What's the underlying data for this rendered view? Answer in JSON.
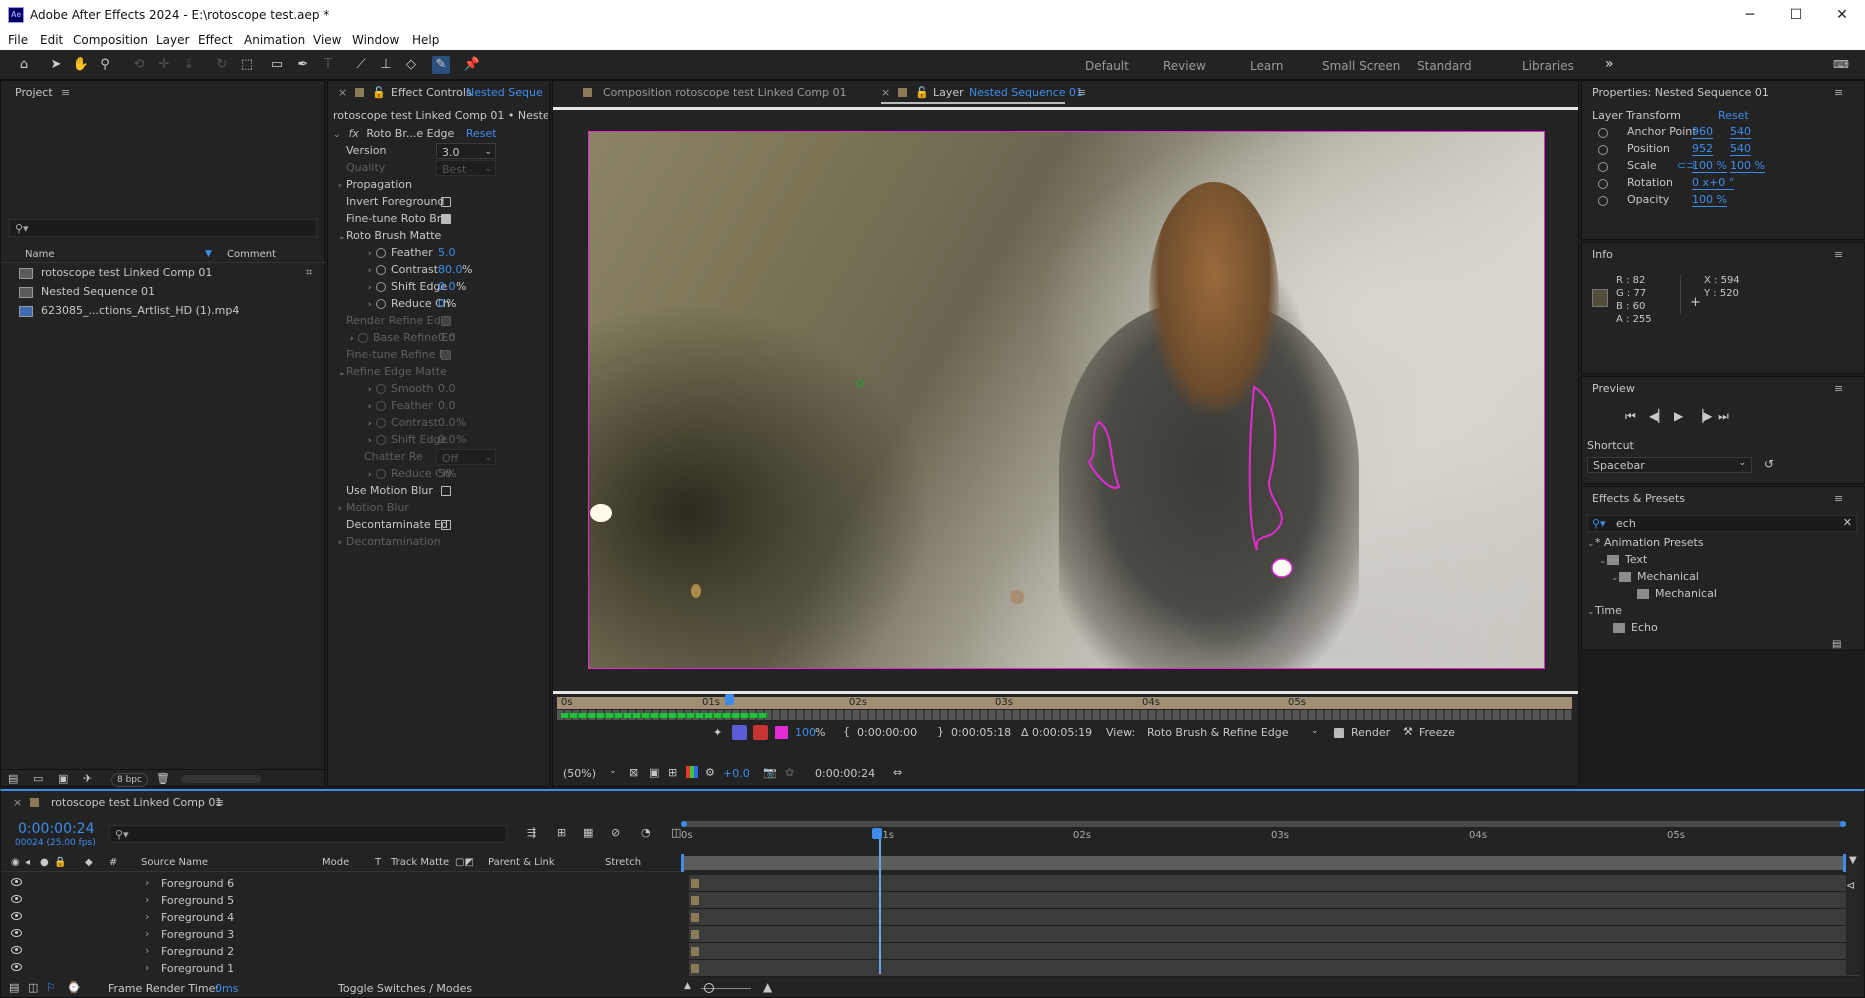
{
  "window": {
    "title": "Adobe After Effects 2024 - E:\\rotoscope test.aep *",
    "app_icon": "Ae",
    "minimize": "─",
    "maximize": "☐",
    "close": "✕"
  },
  "menu": [
    "File",
    "Edit",
    "Composition",
    "Layer",
    "Effect",
    "Animation",
    "View",
    "Window",
    "Help"
  ],
  "workspaces": [
    "Default",
    "Review",
    "Learn",
    "Small Screen",
    "Standard",
    "Libraries"
  ],
  "workspace_more": "»",
  "project": {
    "title": "Project",
    "search_placeholder": "",
    "columns": {
      "name": "Name",
      "comment": "Comment"
    },
    "items": [
      {
        "name": "rotoscope test Linked Comp 01",
        "icon": "composition-icon"
      },
      {
        "name": "Nested Sequence 01",
        "icon": "composition-icon"
      },
      {
        "name": "623085_...ctions_Artlist_HD (1).mp4",
        "icon": "footage-icon"
      }
    ],
    "bpc": "8 bpc"
  },
  "effect_controls": {
    "tab_label": "Effect Controls",
    "tab_target": "Nested Seque",
    "header": "rotoscope test Linked Comp 01 • Nested Seq",
    "effect_name": "Roto Br...e Edge",
    "reset": "Reset",
    "fx": "fx",
    "rows": [
      {
        "label": "Version",
        "value": "3.0",
        "kind": "dropdown"
      },
      {
        "label": "Quality",
        "value": "Best",
        "kind": "dropdown",
        "dim": true
      },
      {
        "label": "Propagation",
        "kind": "group"
      },
      {
        "label": "Invert Foreground",
        "kind": "checkbox",
        "checked": false
      },
      {
        "label": "Fine-tune Roto Br",
        "kind": "checkbox",
        "checked": true
      },
      {
        "label": "Roto Brush Matte",
        "kind": "group-open"
      },
      {
        "label": "Feather",
        "value": "5.0",
        "unit": "",
        "kind": "param"
      },
      {
        "label": "Contrast",
        "value": "80.0",
        "unit": "%",
        "kind": "param"
      },
      {
        "label": "Shift Edge",
        "value": "0.0",
        "unit": "%",
        "kind": "param"
      },
      {
        "label": "Reduce Ch",
        "value": "0",
        "unit": "%",
        "kind": "param"
      },
      {
        "label": "Render Refine Edg",
        "kind": "checkbox",
        "checked": true,
        "dim": true
      },
      {
        "label": "Base Refine Ed",
        "value": "0.0",
        "kind": "param",
        "dim": true
      },
      {
        "label": "Fine-tune Refine E",
        "kind": "checkbox",
        "checked": true,
        "dim": true
      },
      {
        "label": "Refine Edge Matte",
        "kind": "group-open",
        "dim": true
      },
      {
        "label": "Smooth",
        "value": "0.0",
        "kind": "param",
        "dim": true
      },
      {
        "label": "Feather",
        "value": "0.0",
        "kind": "param",
        "dim": true
      },
      {
        "label": "Contrast",
        "value": "0.0",
        "unit": "%",
        "kind": "param",
        "dim": true
      },
      {
        "label": "Shift Edge",
        "value": "0.0",
        "unit": "%",
        "kind": "param",
        "dim": true
      },
      {
        "label": "Chatter Re",
        "value": "Off",
        "kind": "dropdown",
        "dim": true
      },
      {
        "label": "Reduce Ch",
        "value": "50",
        "unit": "%",
        "kind": "param",
        "dim": true
      },
      {
        "label": "Use Motion Blur",
        "kind": "checkbox",
        "checked": false
      },
      {
        "label": "Motion Blur",
        "kind": "group",
        "dim": true
      },
      {
        "label": "Decontaminate Ed",
        "kind": "checkbox",
        "checked": false
      },
      {
        "label": "Decontamination",
        "kind": "group",
        "dim": true
      }
    ]
  },
  "viewer": {
    "comp_tab": "Composition rotoscope test Linked Comp 01",
    "layer_tab_prefix": "Layer",
    "layer_tab_name": "Nested Sequence 01",
    "ruler_labels": [
      "0s",
      "01s",
      "02s",
      "03s",
      "04s",
      "05s"
    ],
    "controls": {
      "zoom_value": "100",
      "zoom_unit": "%",
      "in": "0:00:00:00",
      "out": "0:00:05:18",
      "duration": "Δ 0:00:05:19",
      "view_label": "View:",
      "view_value": "Roto Brush & Refine Edge",
      "render": "Render",
      "freeze": "Freeze"
    },
    "bottom": {
      "magnification": "(50%)",
      "exposure": "+0.0",
      "timecode": "0:00:00:24"
    }
  },
  "properties": {
    "title": "Properties: Nested Sequence 01",
    "section": "Layer Transform",
    "reset": "Reset",
    "rows": [
      {
        "label": "Anchor Point",
        "v1": "960",
        "v2": "540"
      },
      {
        "label": "Position",
        "v1": "952",
        "v2": "540"
      },
      {
        "label": "Scale",
        "v1": "100 %",
        "v2": "100 %"
      },
      {
        "label": "Rotation",
        "v1": "0 x+0 °",
        "v2": ""
      },
      {
        "label": "Opacity",
        "v1": "100 %",
        "v2": ""
      }
    ]
  },
  "info": {
    "title": "Info",
    "r": "R : 82",
    "g": "G : 77",
    "b": "B : 60",
    "a": "A : 255",
    "x": "X : 594",
    "y": "Y : 520",
    "swatch": "#524d3c"
  },
  "preview": {
    "title": "Preview",
    "shortcut_label": "Shortcut",
    "shortcut_value": "Spacebar"
  },
  "effects_presets": {
    "title": "Effects & Presets",
    "search": "ech",
    "tree": [
      {
        "label": "* Animation Presets",
        "depth": 0,
        "kind": "folder-open"
      },
      {
        "label": "Text",
        "depth": 1,
        "kind": "folder"
      },
      {
        "label": "Mechanical",
        "depth": 2,
        "kind": "folder"
      },
      {
        "label": "Mechanical",
        "depth": 3,
        "kind": "preset"
      },
      {
        "label": "Time",
        "depth": 0,
        "kind": "folder-open"
      },
      {
        "label": "Echo",
        "depth": 1,
        "kind": "effect"
      }
    ]
  },
  "timeline": {
    "tab": "rotoscope test Linked Comp 01",
    "timecode": "0:00:00:24",
    "fps": "00024 (25.00 fps)",
    "columns": {
      "num": "#",
      "source": "Source Name",
      "mode": "Mode",
      "t": "T",
      "track_matte": "Track Matte",
      "parent": "Parent & Link",
      "stretch": "Stretch"
    },
    "ruler_labels": [
      "0s",
      "01s",
      "02s",
      "03s",
      "04s",
      "05s"
    ],
    "layers": [
      "Foreground 6",
      "Foreground 5",
      "Foreground 4",
      "Foreground 3",
      "Foreground 2",
      "Foreground 1"
    ],
    "footer": {
      "render_label": "Frame Render Time:",
      "render_value": "0ms",
      "toggle": "Toggle Switches / Modes"
    }
  }
}
